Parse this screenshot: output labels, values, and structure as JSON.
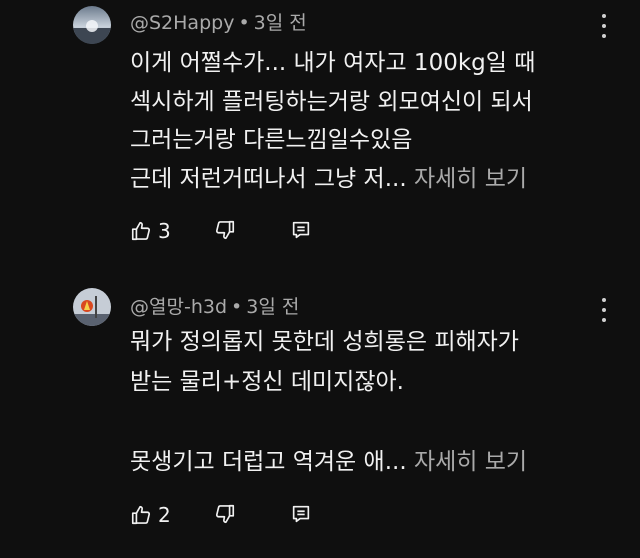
{
  "comments": [
    {
      "author": "@S2Happy",
      "time": "3일 전",
      "text": "이게 어쩔수가... 내가 여자고 100kg일 때\n섹시하게 플러팅하는거랑 외모여신이 되서\n그러는거랑 다른느낌일수있음\n근데 저런거떠나서 그냥 저... ",
      "read_more": "자세히 보기",
      "likes": "3"
    },
    {
      "author": "@열망-h3d",
      "time": "3일 전",
      "text": "뭐가 정의롭지 못한데 성희롱은 피해자가\n받는 물리+정신 데미지잖아.\n\n못생기고 더럽고 역겨운 애... ",
      "read_more": "자세히 보기",
      "likes": "2"
    }
  ],
  "separator": "•",
  "colors": {
    "background": "#0f0f0f",
    "text": "#f1f1f1",
    "secondary": "#aaaaaa"
  },
  "icons": [
    "thumb-up-icon",
    "thumb-down-icon",
    "reply-icon",
    "more-vert-icon"
  ]
}
